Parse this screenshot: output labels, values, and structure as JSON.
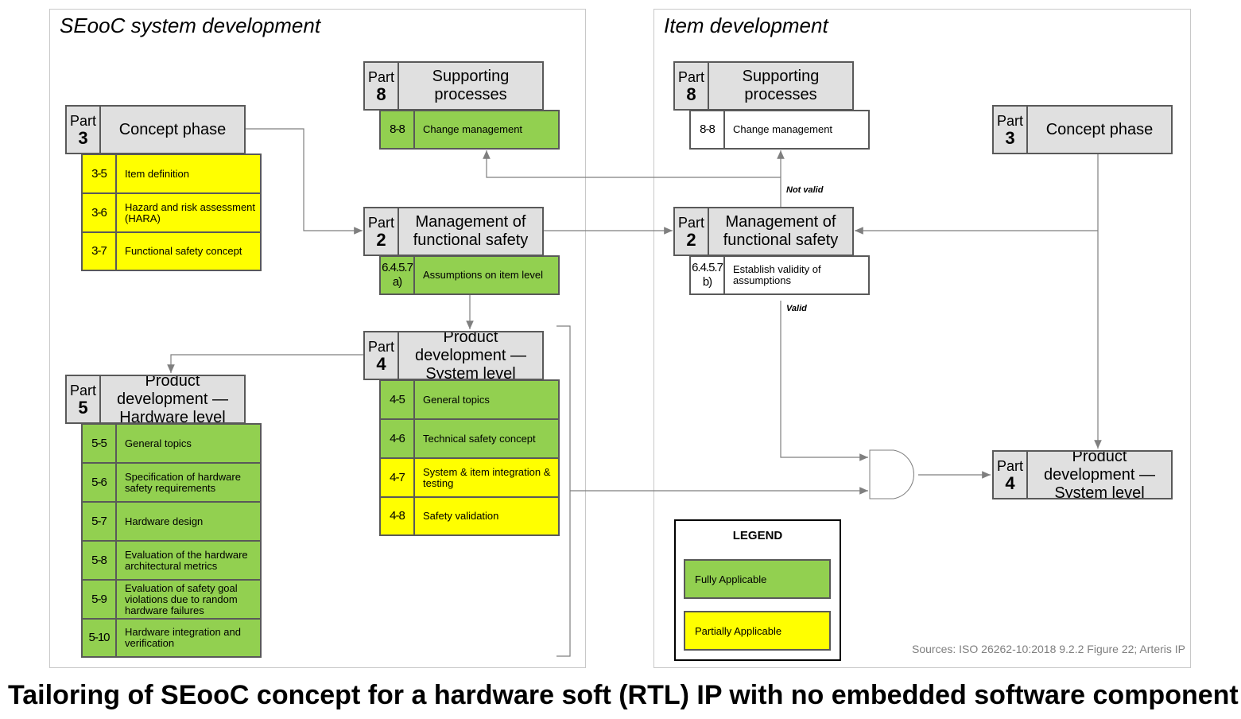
{
  "left_panel": {
    "title": "SEooC system development"
  },
  "right_panel": {
    "title": "Item development"
  },
  "part_label": "Part",
  "blocks": {
    "l_part8": {
      "part": "8",
      "title": "Supporting processes",
      "rows": [
        {
          "num": "8-8",
          "label": "Change management",
          "status": "fully"
        }
      ]
    },
    "l_part3": {
      "part": "3",
      "title": "Concept phase",
      "rows": [
        {
          "num": "3-5",
          "label": "Item definition",
          "status": "partially"
        },
        {
          "num": "3-6",
          "label": "Hazard and risk assessment (HARA)",
          "status": "partially"
        },
        {
          "num": "3-7",
          "label": "Functional safety concept",
          "status": "partially"
        }
      ]
    },
    "l_part2": {
      "part": "2",
      "title": "Management of functional safety",
      "rows": [
        {
          "num": "6.4.5.7 a)",
          "label": "Assumptions on item level",
          "status": "fully"
        }
      ]
    },
    "l_part4": {
      "part": "4",
      "title": "Product development — System level",
      "rows": [
        {
          "num": "4-5",
          "label": "General topics",
          "status": "fully"
        },
        {
          "num": "4-6",
          "label": "Technical safety concept",
          "status": "fully"
        },
        {
          "num": "4-7",
          "label": "System & item integration & testing",
          "status": "partially"
        },
        {
          "num": "4-8",
          "label": "Safety validation",
          "status": "partially"
        }
      ]
    },
    "l_part5": {
      "part": "5",
      "title": "Product development — Hardware level",
      "rows": [
        {
          "num": "5-5",
          "label": "General topics",
          "status": "fully"
        },
        {
          "num": "5-6",
          "label": "Specification of hardware safety requirements",
          "status": "fully"
        },
        {
          "num": "5-7",
          "label": "Hardware design",
          "status": "fully"
        },
        {
          "num": "5-8",
          "label": "Evaluation of the hardware architectural metrics",
          "status": "fully"
        },
        {
          "num": "5-9",
          "label": "Evaluation of safety goal violations due to random hardware failures",
          "status": "fully"
        },
        {
          "num": "5-10",
          "label": "Hardware integration and verification",
          "status": "fully"
        }
      ]
    },
    "r_part8": {
      "part": "8",
      "title": "Supporting processes",
      "rows": [
        {
          "num": "8-8",
          "label": "Change management",
          "status": "none"
        }
      ]
    },
    "r_part2": {
      "part": "2",
      "title": "Management of functional safety",
      "rows": [
        {
          "num": "6.4.5.7 b)",
          "label": "Establish validity of assumptions",
          "status": "none"
        }
      ]
    },
    "r_part3": {
      "part": "3",
      "title": "Concept phase",
      "rows": []
    },
    "r_part4": {
      "part": "4",
      "title": "Product development — System level",
      "rows": []
    }
  },
  "edge_labels": {
    "not_valid": "Not valid",
    "valid": "Valid"
  },
  "legend": {
    "title": "LEGEND",
    "fully": "Fully Applicable",
    "partially": "Partially Applicable"
  },
  "colors": {
    "fully": "#92d050",
    "partially": "#ffff00",
    "none": "#ffffff",
    "header": "#e0e0e0"
  },
  "sources": "Sources: ISO 26262-10:2018 9.2.2 Figure 22; Arteris IP",
  "caption": "Tailoring of SEooC concept for a hardware soft (RTL) IP with no embedded software component"
}
